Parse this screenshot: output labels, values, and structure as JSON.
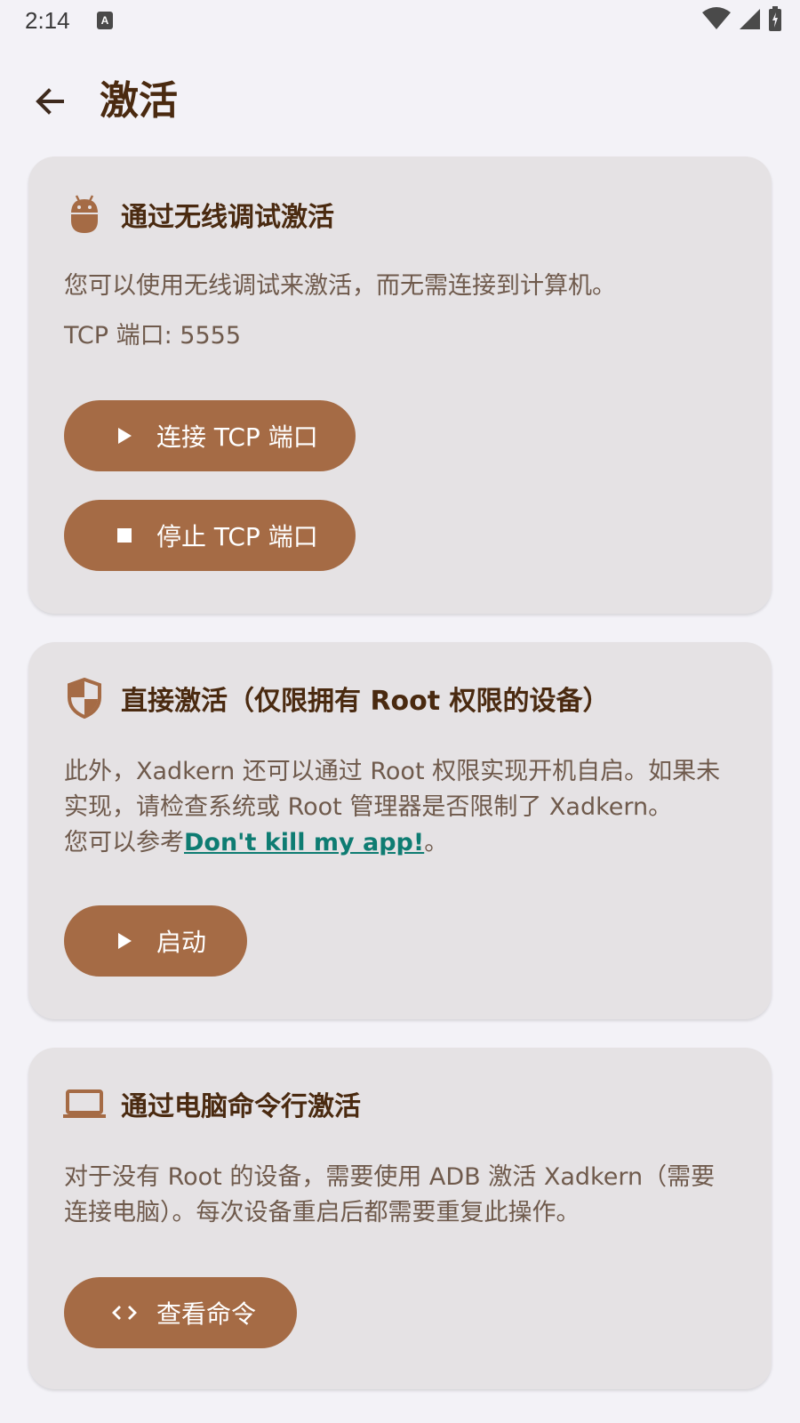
{
  "status_bar": {
    "time": "2:14"
  },
  "app_bar": {
    "title": "激活"
  },
  "cards": {
    "wireless": {
      "title": "通过无线调试激活",
      "description": "您可以使用无线调试来激活，而无需连接到计算机。",
      "port_text": "TCP 端口: 5555",
      "connect_label": "连接 TCP 端口",
      "stop_label": "停止 TCP 端口"
    },
    "root": {
      "title": "直接激活（仅限拥有 Root 权限的设备）",
      "description": "此外，Xadkern 还可以通过 Root 权限实现开机自启。如果未实现，请检查系统或 Root 管理器是否限制了 Xadkern。",
      "ref_prefix": "您可以参考",
      "link_text": "Don't kill my app!",
      "ref_suffix": "。",
      "start_label": "启动"
    },
    "pc": {
      "title": "通过电脑命令行激活",
      "description": "对于没有 Root 的设备，需要使用 ADB 激活 Xadkern（需要连接电脑）。每次设备重启后都需要重复此操作。",
      "view_label": "查看命令"
    }
  },
  "icons": {
    "back": "arrow-back-icon",
    "wireless": "android-icon",
    "root": "shield-icon",
    "pc": "laptop-icon",
    "play": "play-icon",
    "stop": "stop-icon",
    "code": "code-icon"
  },
  "colors": {
    "background": "#f3f2f7",
    "card": "#e5e2e4",
    "accent": "#a56b45",
    "title": "#4a2a10",
    "body_text": "#6f5a4c",
    "link": "#0e7c72"
  }
}
